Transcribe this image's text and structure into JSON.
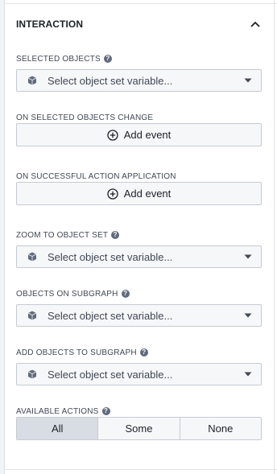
{
  "section": {
    "title": "INTERACTION"
  },
  "fields": {
    "selected_objects": {
      "label": "SELECTED OBJECTS",
      "placeholder": "Select object set variable..."
    },
    "on_selected_objects_change": {
      "label": "ON SELECTED OBJECTS CHANGE",
      "button_label": "Add event"
    },
    "on_successful_action_application": {
      "label": "ON SUCCESSFUL ACTION APPLICATION",
      "button_label": "Add event"
    },
    "zoom_to_object_set": {
      "label": "ZOOM TO OBJECT SET",
      "placeholder": "Select object set variable..."
    },
    "objects_on_subgraph": {
      "label": "OBJECTS ON SUBGRAPH",
      "placeholder": "Select object set variable..."
    },
    "add_objects_to_subgraph": {
      "label": "ADD OBJECTS TO SUBGRAPH",
      "placeholder": "Select object set variable..."
    },
    "available_actions": {
      "label": "AVAILABLE ACTIONS",
      "options": [
        "All",
        "Some",
        "None"
      ],
      "selected": "All"
    }
  },
  "icons": {
    "collapse": "chevron-up-icon",
    "help": "help-icon",
    "object": "cube-icon",
    "caret": "caret-down-icon",
    "add": "add-circle-icon"
  },
  "colors": {
    "text": "#1c2127",
    "muted": "#404854",
    "icon": "#5f6b7c",
    "border": "#c5cbd3",
    "field_bg": "#f6f7f9",
    "active_bg": "#d8dde4"
  }
}
